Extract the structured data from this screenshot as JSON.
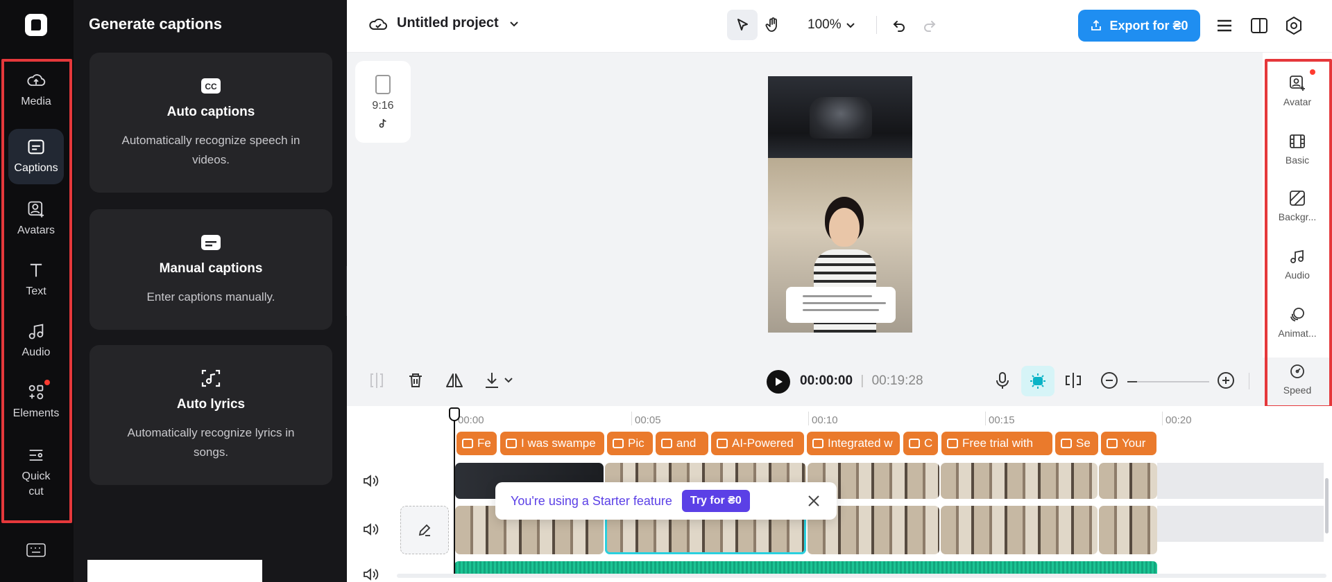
{
  "rail": {
    "items": [
      {
        "label": "Media"
      },
      {
        "label": "Captions"
      },
      {
        "label": "Avatars"
      },
      {
        "label": "Text"
      },
      {
        "label": "Audio"
      },
      {
        "label": "Elements"
      },
      {
        "label": "Quick cut"
      }
    ]
  },
  "panel": {
    "title": "Generate captions",
    "cards": [
      {
        "title": "Auto captions",
        "desc": "Automatically recognize speech in videos.",
        "icon": "cc-icon"
      },
      {
        "title": "Manual captions",
        "desc": "Enter captions manually.",
        "icon": "subtitle-icon"
      },
      {
        "title": "Auto lyrics",
        "desc": "Automatically recognize lyrics in songs.",
        "icon": "lyrics-icon"
      }
    ]
  },
  "topbar": {
    "project_name": "Untitled project",
    "zoom": "100%",
    "export_label": "Export for ₴0"
  },
  "canvas": {
    "ratio_label": "9:16"
  },
  "right_rail": {
    "items": [
      {
        "label": "Avatar"
      },
      {
        "label": "Basic"
      },
      {
        "label": "Backgr..."
      },
      {
        "label": "Audio"
      },
      {
        "label": "Animat..."
      },
      {
        "label": "Speed"
      }
    ]
  },
  "timeline": {
    "current_time": "00:00:00",
    "duration": "00:19:28",
    "ruler": [
      "00:00",
      "00:05",
      "00:10",
      "00:15",
      "00:20"
    ],
    "captions": [
      "Fe",
      "I was swampe",
      "Pic",
      "and",
      "AI-Powered",
      "Integrated w",
      "C",
      "Free trial with",
      "Se",
      "Your"
    ]
  },
  "toast": {
    "message": "You're using a Starter feature",
    "button": "Try for ₴0"
  },
  "colors": {
    "accent": "#1f8ef1",
    "caption_clip": "#ea7a2c",
    "starter": "#5b40e6",
    "highlight_box": "#e5383b"
  }
}
